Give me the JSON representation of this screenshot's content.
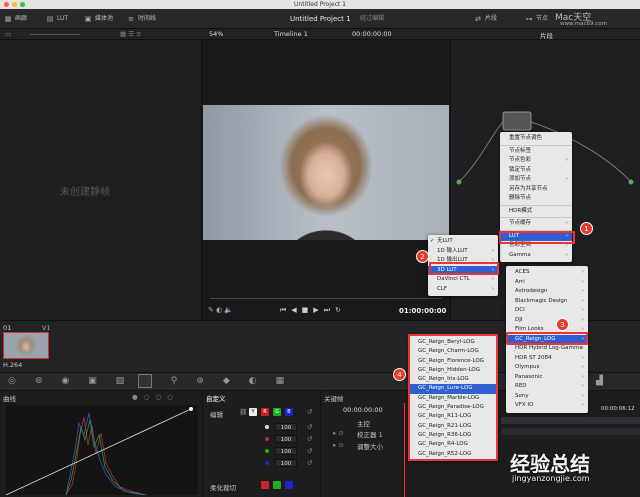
{
  "window": {
    "title": "Untitled Project 1"
  },
  "topbar": {
    "media": "画廊",
    "lut": "LUT",
    "media_pool": "媒体池",
    "timeline": "时间线",
    "project_title": "Untitled Project 1",
    "edited": "经过编辑",
    "clips": "片段",
    "nodes": "节点",
    "watermark_top": "Mac天空",
    "watermark_url": "www.mac69.com"
  },
  "toolbar2": {
    "zoom": "54%",
    "timeline_name": "Timeline 1",
    "timecode": "00:00:00:00",
    "clip_mode": "片段"
  },
  "gallery": {
    "empty_text": "未创建静帧"
  },
  "transport": {
    "timecode": "01:00:00:00"
  },
  "clip": {
    "index": "01",
    "track": "V1",
    "codec": "H.264"
  },
  "context_menu": {
    "items": [
      {
        "label": "重置节点调色"
      },
      {
        "label": "节点标签"
      },
      {
        "label": "节点色彩",
        "sub": true
      },
      {
        "label": "锁定节点"
      },
      {
        "label": "添加节点",
        "sub": true
      },
      {
        "label": "另存为共享节点"
      },
      {
        "label": "删除节点"
      },
      {
        "label": "HDR模式"
      },
      {
        "label": "节点缓存",
        "sub": true
      },
      {
        "label": "LUT",
        "sub": true
      },
      {
        "label": "色彩空间",
        "sub": true
      },
      {
        "label": "Gamma",
        "sub": true
      }
    ]
  },
  "lut_submenu": {
    "items": [
      {
        "label": "无LUT",
        "checked": true
      },
      {
        "label": "1D 输入LUT",
        "sub": true
      },
      {
        "label": "1D 输出LUT",
        "sub": true
      },
      {
        "label": "3D LUT",
        "sub": true
      },
      {
        "label": "DaVinci CTL",
        "sub": true
      },
      {
        "label": "CLF",
        "sub": true
      }
    ]
  },
  "lut3d_submenu": {
    "items": [
      "ACES",
      "Arri",
      "Astrodesign",
      "Blackmagic Design",
      "DCI",
      "DJI",
      "Film Looks",
      "GC_Reign_LOG",
      "HDR Hybrid Log-Gamma",
      "HDR ST 2084",
      "Olympus",
      "Panasonic",
      "RED",
      "Sony",
      "VFX IO"
    ]
  },
  "gc_submenu": {
    "items": [
      "GC_Reign_Beryl-LOG",
      "GC_Reign_Charm-LOG",
      "GC_Reign_Florence-LOG",
      "GC_Reign_Hidden-LOG",
      "GC_Reign_Iris-LOG",
      "GC_Reign_Lure-LOG",
      "GC_Reign_Marble-LOG",
      "GC_Reign_Paradise-LOG",
      "GC_Reign_R11-LOG",
      "GC_Reign_R21-LOG",
      "GC_Reign_R36-LOG",
      "GC_Reign_R4-LOG",
      "GC_Reign_R52-LOG"
    ]
  },
  "badges": {
    "b1": "1",
    "b2": "2",
    "b3": "3",
    "b4": "4"
  },
  "curves": {
    "title": "曲线",
    "mode": "自定义"
  },
  "edit": {
    "title": "编辑",
    "values": [
      "100",
      "100",
      "100",
      "100"
    ],
    "soft_clip": "柔化裁切",
    "y": "Y",
    "r": "R",
    "g": "G",
    "b": "B"
  },
  "keyframes": {
    "title": "关键帧",
    "all": "全部",
    "timecode": "00:00:00:00",
    "master": "主控",
    "corrector": "校正器 1",
    "resize": "调整大小",
    "end_tc": "00:00:06:12"
  },
  "watermark_bottom": {
    "text": "经验总结",
    "url": "jingyanzongjie.com"
  },
  "colors": {
    "accent_red": "#e33a2e",
    "highlight": "#2f5fd0"
  }
}
